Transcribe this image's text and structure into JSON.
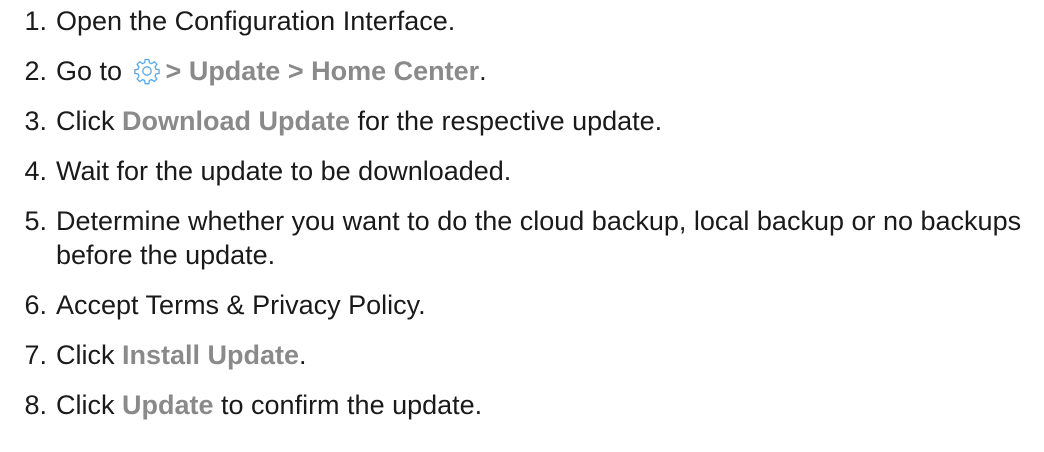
{
  "steps": [
    {
      "number": "1.",
      "parts": {
        "t1": "Open the Configuration Interface."
      }
    },
    {
      "number": "2.",
      "parts": {
        "t1": "Go to ",
        "icon": "gear-icon",
        "ui1": "> Update > Home Center",
        "t2": "."
      }
    },
    {
      "number": "3.",
      "parts": {
        "t1": "Click ",
        "ui1": "Download Update",
        "t2": " for the respective update."
      }
    },
    {
      "number": "4.",
      "parts": {
        "t1": "Wait for the update to be downloaded."
      }
    },
    {
      "number": "5.",
      "parts": {
        "t1": "Determine whether you want to do the cloud backup, local backup or no backups before the update."
      }
    },
    {
      "number": "6.",
      "parts": {
        "t1": "Accept Terms & Privacy Policy."
      }
    },
    {
      "number": "7.",
      "parts": {
        "t1": "Click ",
        "ui1": "Install Update",
        "t2": "."
      }
    },
    {
      "number": "8.",
      "parts": {
        "t1": "Click ",
        "ui1": "Update",
        "t2": " to confirm the update."
      }
    }
  ],
  "colors": {
    "text": "#1a1a1a",
    "ui_label": "#8a8a8a",
    "icon": "#5aa9e6"
  }
}
